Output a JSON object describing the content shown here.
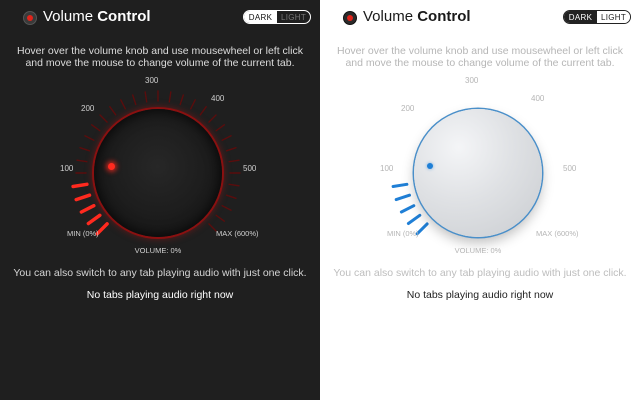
{
  "app": {
    "title_part1": "Volume ",
    "title_part2": "Control"
  },
  "theme_switch": {
    "dark_label": "DARK",
    "light_label": "LIGHT"
  },
  "instructions": "Hover over the volume knob and use mousewheel or left click and move the mouse to change volume of the current tab.",
  "scale": {
    "labels": [
      "100",
      "200",
      "300",
      "400",
      "500"
    ],
    "min_label": "MIN (0%)",
    "max_label": "MAX (600%)"
  },
  "volume": {
    "readout": "VOLUME: 0%",
    "level_percent": 0
  },
  "switch_note": "You can also switch to any tab playing audio with just one click.",
  "no_tabs_message": "No tabs playing audio right now",
  "panels": {
    "dark": {
      "theme": "dark",
      "accent_color": "#ff2a1f",
      "background": "#1f1f1f"
    },
    "light": {
      "theme": "light",
      "accent_color": "#1f7fd6",
      "background": "#ffffff"
    }
  },
  "icons": {
    "logo": "speaker-knob-logo-icon"
  }
}
